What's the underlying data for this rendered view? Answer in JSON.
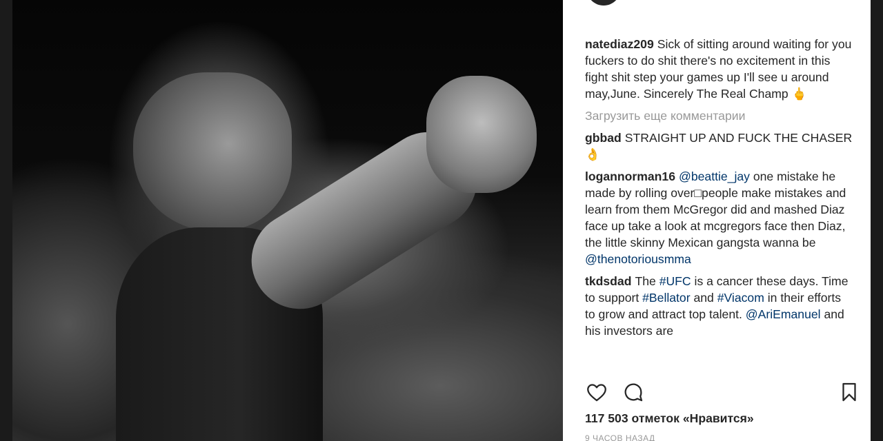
{
  "post": {
    "image_alt": "",
    "caption": {
      "user": "natediaz209",
      "text": "Sick of sitting around waiting for you fuckers to do shit there's no excitement in this fight shit step your games up I'll see u around may,June. Sincerely The Real Champ 🖕"
    },
    "load_more_label": "Загрузить еще комментарии",
    "comments": [
      {
        "user": "gbbad",
        "text": "STRAIGHT UP AND FUCK THE CHASER👌"
      },
      {
        "user": "logannorman16",
        "mention": "@beattie_jay",
        "text": " one mistake he made by rolling over□people make mistakes and learn from them McGregor did and mashed Diaz face up take a look at mcgregors face then Diaz, the little skinny Mexican gangsta wanna be ",
        "mention2": "@thenotoriousmma"
      },
      {
        "user": "tkdsdad",
        "parts": {
          "t1": "The ",
          "h1": "#UFC",
          "t2": " is a cancer these days. Time to support ",
          "h2": "#Bellator",
          "t3": " and ",
          "h3": "#Viacom",
          "t4": " in their efforts to grow and attract top talent. ",
          "m1": "@AriEmanuel",
          "t5": " and his investors are"
        }
      }
    ],
    "actions": {
      "like_icon": "heart-icon",
      "comment_icon": "comment-bubble-icon",
      "save_icon": "bookmark-icon"
    },
    "likes_text": "117 503 отметок «Нравится»",
    "timestamp": "9 ЧАСОВ НАЗАД"
  },
  "colors": {
    "text": "#262626",
    "muted": "#999999",
    "link": "#003569",
    "background": "#1b1b1b"
  }
}
